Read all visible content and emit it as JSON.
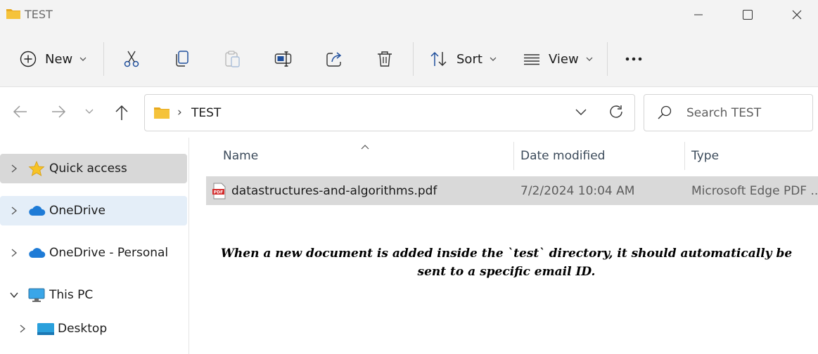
{
  "window": {
    "title": "TEST"
  },
  "toolbar": {
    "new_label": "New",
    "sort_label": "Sort",
    "view_label": "View"
  },
  "address": {
    "path": "TEST",
    "search_placeholder": "Search TEST"
  },
  "sidebar": {
    "items": [
      {
        "label": "Quick access"
      },
      {
        "label": "OneDrive"
      },
      {
        "label": "OneDrive - Personal"
      },
      {
        "label": "This PC"
      },
      {
        "label": "Desktop"
      }
    ]
  },
  "list": {
    "columns": [
      "Name",
      "Date modified",
      "Type"
    ],
    "rows": [
      {
        "name": "datastructures-and-algorithms.pdf",
        "date": "7/2/2024 10:04 AM",
        "type": "Microsoft Edge PDF ..."
      }
    ]
  },
  "note": "When a new document is added inside the `test` directory, it should automatically be sent to a specific email ID.",
  "colors": {
    "chrome": "#f3f3f3",
    "selected_row": "#d9d9d9",
    "quick_access_bg": "#d8d8d8",
    "onedrive_bg": "#e4eef8",
    "folder_yellow": "#f5c33b",
    "onedrive_blue": "#1e7bd6"
  }
}
